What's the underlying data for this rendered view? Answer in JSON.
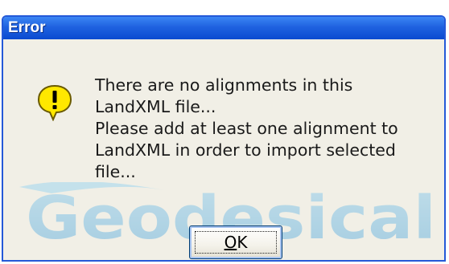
{
  "dialog": {
    "title": "Error",
    "message_lines": [
      "There are no alignments in this",
      "LandXML file...",
      "Please add at least one alignment to",
      "LandXML in order to import selected",
      "file..."
    ],
    "icon": "warning-icon",
    "ok_label": "OK"
  },
  "watermark": {
    "text": "Geodesical"
  },
  "colors": {
    "titlebar": "#1f62e0",
    "dialog_bg": "#ece9d8",
    "icon_fill": "#ffe800",
    "watermark": "#5ab4e6"
  }
}
